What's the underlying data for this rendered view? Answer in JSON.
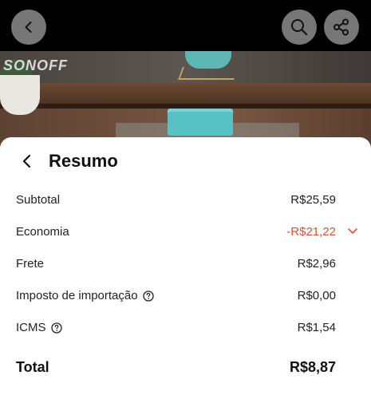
{
  "hero": {
    "brand": "SONOFF",
    "icons": [
      "back-icon",
      "search-icon",
      "share-icon"
    ]
  },
  "summary": {
    "title": "Resumo",
    "rows": [
      {
        "label": "Subtotal",
        "value": "R$25,59"
      },
      {
        "label": "Economia",
        "value": "-R$21,22"
      },
      {
        "label": "Frete",
        "value": "R$2,96"
      },
      {
        "label": "Imposto de importação",
        "value": "R$0,00"
      },
      {
        "label": "ICMS",
        "value": "R$1,54"
      }
    ],
    "total_label": "Total",
    "total_value": "R$8,87"
  },
  "colors": {
    "discount": "#e0532d",
    "button_bg": "#8c8c8c"
  }
}
